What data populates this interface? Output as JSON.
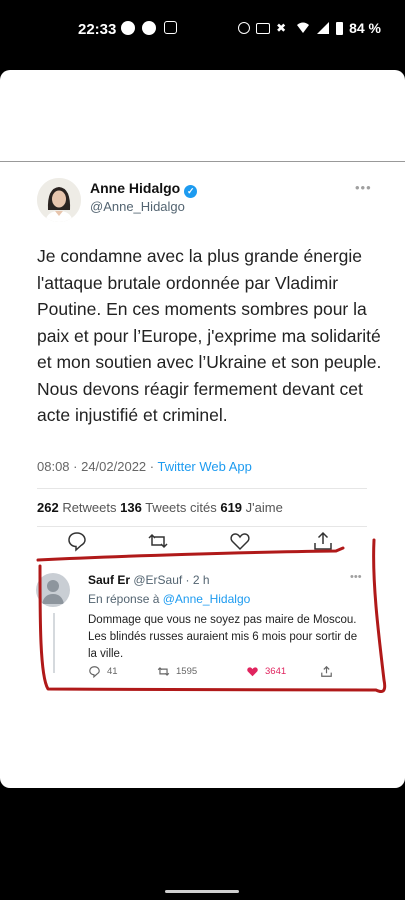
{
  "status_bar": {
    "time": "22:33",
    "battery": "84 %"
  },
  "tweet": {
    "author_name": "Anne Hidalgo",
    "author_handle": "@Anne_Hidalgo",
    "text": "Je condamne avec la plus grande énergie l'attaque brutale ordonnée par Vladimir Poutine. En ces moments sombres pour la paix et pour l’Europe, j'exprime ma solidarité et mon soutien avec l’Ukraine et son peuple. Nous devons réagir fermement devant cet acte injustifié et criminel.",
    "timestamp": "08:08 · 24/02/2022 · ",
    "app": "Twitter Web App",
    "retweets_count": "262",
    "retweets_label": " Retweets ",
    "quotes_count": "136",
    "quotes_label": " Tweets cités ",
    "likes_count": "619",
    "likes_label": " J'aime"
  },
  "reply": {
    "author_name": "Sauf Er",
    "author_handle": " @ErSauf · 2 h",
    "in_reply_prefix": "En réponse à ",
    "in_reply_handle": "@Anne_Hidalgo",
    "text": "Dommage que vous ne soyez pas maire de Moscou. Les blindés russes auraient mis 6 mois pour sortir de la ville.",
    "replies": "41",
    "retweets": "1595",
    "likes": "3641"
  },
  "colors": {
    "accent": "#1d9bf0",
    "annotation": "#b01919",
    "like": "#e0245e"
  }
}
